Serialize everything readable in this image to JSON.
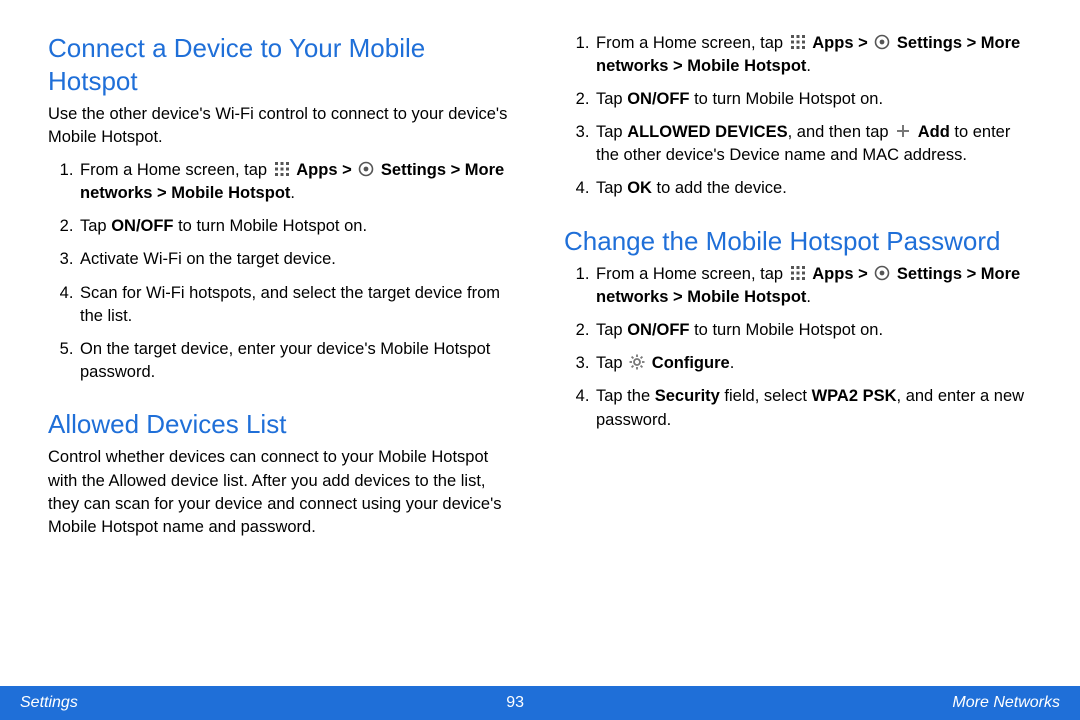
{
  "left": {
    "h1": "Connect a Device to Your Mobile Hotspot",
    "intro1": "Use the other device's Wi-Fi control to connect to your device's Mobile Hotspot.",
    "steps1": {
      "s1a": "From a Home screen, tap ",
      "s1_apps": "Apps > ",
      "s1_settings": "Settings > More networks > Mobile Hotspot",
      "s1b": ".",
      "s2a": "Tap ",
      "s2b": "ON/OFF",
      "s2c": " to turn Mobile Hotspot on.",
      "s3": "Activate Wi-Fi on the target device.",
      "s4": "Scan for Wi-Fi hotspots, and select the target device from the list.",
      "s5": "On the target device, enter your device's Mobile Hotspot password."
    },
    "h2": "Allowed Devices List",
    "intro2": "Control whether devices can connect to your Mobile Hotspot with the Allowed device list. After you add devices to the list, they can scan for your device and connect using your device's Mobile Hotspot name and password."
  },
  "right": {
    "stepsA": {
      "s1a": "From a Home screen, tap ",
      "s1_apps": "Apps > ",
      "s1_settings": "Settings > More networks > Mobile Hotspot",
      "s1b": ".",
      "s2a": "Tap ",
      "s2b": "ON/OFF",
      "s2c": " to turn Mobile Hotspot on.",
      "s3a": "Tap ",
      "s3b": "ALLOWED DEVICES",
      "s3c": ", and then tap ",
      "s3_add": "Add",
      "s3d": " to enter the other device's Device name and MAC address.",
      "s4a": "Tap ",
      "s4b": "OK",
      "s4c": " to add the device."
    },
    "h1": "Change the Mobile Hotspot Password",
    "stepsB": {
      "s1a": "From a Home screen, tap ",
      "s1_apps": "Apps > ",
      "s1_settings": "Settings > More networks > Mobile Hotspot",
      "s1b": ".",
      "s2a": "Tap ",
      "s2b": "ON/OFF",
      "s2c": " to turn Mobile Hotspot on.",
      "s3a": "Tap ",
      "s3_conf": "Configure",
      "s3b": ".",
      "s4a": "Tap the ",
      "s4b": "Security",
      "s4c": " field, select ",
      "s4d": "WPA2 PSK",
      "s4e": ", and enter a new password."
    }
  },
  "footer": {
    "left": "Settings",
    "center": "93",
    "right": "More Networks"
  }
}
